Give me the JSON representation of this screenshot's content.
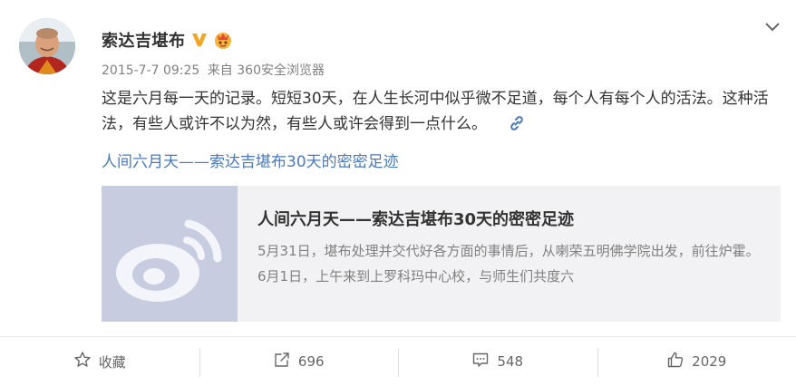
{
  "post": {
    "user": {
      "name": "索达吉堪布",
      "verified_badge": "verified-v-icon",
      "vip_badge": "vip-icon"
    },
    "meta": {
      "date": "2015-7-7 09:25",
      "source_prefix": "来自",
      "source": "360安全浏览器"
    },
    "text": "这是六月每一天的记录。短短30天，在人生长河中似乎微不足道，每个人有每个人的活法。这种活法，有些人或许不以为然，有些人或许会得到一点什么。",
    "link_text": "人间六月天——索达吉堪布30天的密密足迹",
    "card": {
      "title": "人间六月天——索达吉堪布30天的密密足迹",
      "description": "5月31日，堪布处理并交代好各方面的事情后，从喇荣五明佛学院出发，前往炉霍。 6月1日，上午来到上罗科玛中心校，与师生们共度六"
    }
  },
  "actions": {
    "favorite": "收藏",
    "repost_count": "696",
    "comment_count": "548",
    "like_count": "2029"
  },
  "colors": {
    "link": "#4a79bd",
    "verified": "#f5a623",
    "card_bg": "#f2f2f5",
    "thumb_bg": "#c8cce0"
  }
}
